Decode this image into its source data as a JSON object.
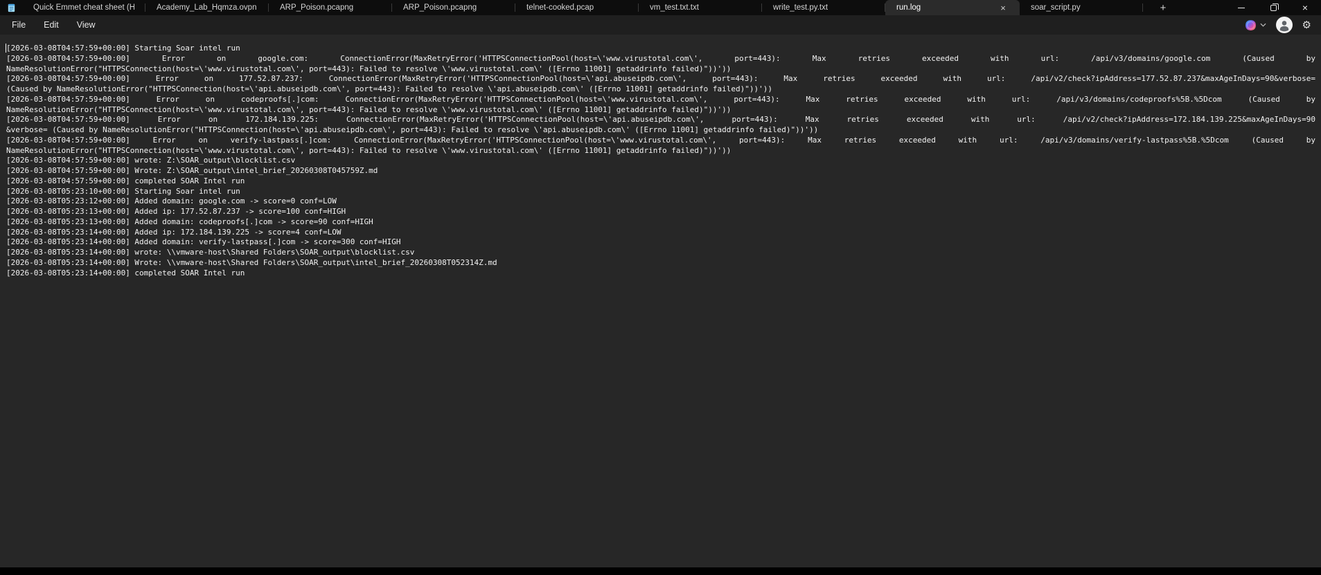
{
  "theme": {
    "titlebar_bg": "#0d0d0d",
    "chrome_bg": "#1f1f1f",
    "editor_bg": "#272727",
    "editor_text": "#f2f2f2",
    "active_tab_bg": "#2b2b2b"
  },
  "icons": {
    "close": "×",
    "close_window": "×",
    "add_tab": "+",
    "gear": "⚙"
  },
  "titlebar": {
    "app": "Notepad",
    "tabs": [
      {
        "label": "Quick Emmet cheat sheet (HTM",
        "active": false
      },
      {
        "label": "Academy_Lab_Hqmza.ovpn",
        "active": false
      },
      {
        "label": "ARP_Poison.pcapng",
        "active": false
      },
      {
        "label": "ARP_Poison.pcapng",
        "active": false
      },
      {
        "label": "telnet-cooked.pcap",
        "active": false
      },
      {
        "label": "vm_test.txt.txt",
        "active": false
      },
      {
        "label": "write_test.py.txt",
        "active": false
      },
      {
        "label": "run.log",
        "active": true
      },
      {
        "label": "soar_script.py",
        "active": false
      }
    ]
  },
  "menu": {
    "items": [
      "File",
      "Edit",
      "View"
    ]
  },
  "editor": {
    "lines": [
      {
        "t": "[2026-03-08T04:57:59+00:00] Starting Soar intel run",
        "j": false
      },
      {
        "t": "[2026-03-08T04:57:59+00:00] Error on google.com: ConnectionError(MaxRetryError('HTTPSConnectionPool(host=\\'www.virustotal.com\\', port=443): Max retries exceeded with url: /api/v3/domains/google.com (Caused by",
        "j": true
      },
      {
        "t": "NameResolutionError(\"HTTPSConnection(host=\\'www.virustotal.com\\', port=443): Failed to resolve \\'www.virustotal.com\\' ([Errno 11001] getaddrinfo failed)\"))'))",
        "j": false
      },
      {
        "t": "[2026-03-08T04:57:59+00:00] Error on 177.52.87.237: ConnectionError(MaxRetryError('HTTPSConnectionPool(host=\\'api.abuseipdb.com\\', port=443): Max retries exceeded with url: /api/v2/check?ipAddress=177.52.87.237&maxAgeInDays=90&verbose=",
        "j": true
      },
      {
        "t": "(Caused by NameResolutionError(\"HTTPSConnection(host=\\'api.abuseipdb.com\\', port=443): Failed to resolve \\'api.abuseipdb.com\\' ([Errno 11001] getaddrinfo failed)\"))'))",
        "j": false
      },
      {
        "t": "[2026-03-08T04:57:59+00:00] Error on codeproofs[.]com: ConnectionError(MaxRetryError('HTTPSConnectionPool(host=\\'www.virustotal.com\\', port=443): Max retries exceeded with url: /api/v3/domains/codeproofs%5B.%5Dcom (Caused by",
        "j": true
      },
      {
        "t": "NameResolutionError(\"HTTPSConnection(host=\\'www.virustotal.com\\', port=443): Failed to resolve \\'www.virustotal.com\\' ([Errno 11001] getaddrinfo failed)\"))'))",
        "j": false
      },
      {
        "t": "[2026-03-08T04:57:59+00:00] Error on 172.184.139.225: ConnectionError(MaxRetryError('HTTPSConnectionPool(host=\\'api.abuseipdb.com\\', port=443): Max retries exceeded with url: /api/v2/check?ipAddress=172.184.139.225&maxAgeInDays=90",
        "j": true
      },
      {
        "t": "&verbose= (Caused by NameResolutionError(\"HTTPSConnection(host=\\'api.abuseipdb.com\\', port=443): Failed to resolve \\'api.abuseipdb.com\\' ([Errno 11001] getaddrinfo failed)\"))'))",
        "j": false
      },
      {
        "t": "[2026-03-08T04:57:59+00:00] Error on verify-lastpass[.]com: ConnectionError(MaxRetryError('HTTPSConnectionPool(host=\\'www.virustotal.com\\', port=443): Max retries exceeded with url: /api/v3/domains/verify-lastpass%5B.%5Dcom (Caused by",
        "j": true
      },
      {
        "t": "NameResolutionError(\"HTTPSConnection(host=\\'www.virustotal.com\\', port=443): Failed to resolve \\'www.virustotal.com\\' ([Errno 11001] getaddrinfo failed)\"))'))",
        "j": false
      },
      {
        "t": "[2026-03-08T04:57:59+00:00] wrote: Z:\\SOAR_output\\blocklist.csv",
        "j": false
      },
      {
        "t": "[2026-03-08T04:57:59+00:00] Wrote: Z:\\SOAR_output\\intel_brief_20260308T045759Z.md",
        "j": false
      },
      {
        "t": "[2026-03-08T04:57:59+00:00] completed SOAR Intel run",
        "j": false
      },
      {
        "t": "[2026-03-08T05:23:10+00:00] Starting Soar intel run",
        "j": false
      },
      {
        "t": "[2026-03-08T05:23:12+00:00] Added domain: google.com -> score=0 conf=LOW",
        "j": false
      },
      {
        "t": "[2026-03-08T05:23:13+00:00] Added ip: 177.52.87.237 -> score=100 conf=HIGH",
        "j": false
      },
      {
        "t": "[2026-03-08T05:23:13+00:00] Added domain: codeproofs[.]com -> score=90 conf=HIGH",
        "j": false
      },
      {
        "t": "[2026-03-08T05:23:14+00:00] Added ip: 172.184.139.225 -> score=4 conf=LOW",
        "j": false
      },
      {
        "t": "[2026-03-08T05:23:14+00:00] Added domain: verify-lastpass[.]com -> score=300 conf=HIGH",
        "j": false
      },
      {
        "t": "[2026-03-08T05:23:14+00:00] wrote: \\\\vmware-host\\Shared Folders\\SOAR_output\\blocklist.csv",
        "j": false
      },
      {
        "t": "[2026-03-08T05:23:14+00:00] Wrote: \\\\vmware-host\\Shared Folders\\SOAR_output\\intel_brief_20260308T052314Z.md",
        "j": false
      },
      {
        "t": "[2026-03-08T05:23:14+00:00] completed SOAR Intel run",
        "j": false
      }
    ]
  }
}
